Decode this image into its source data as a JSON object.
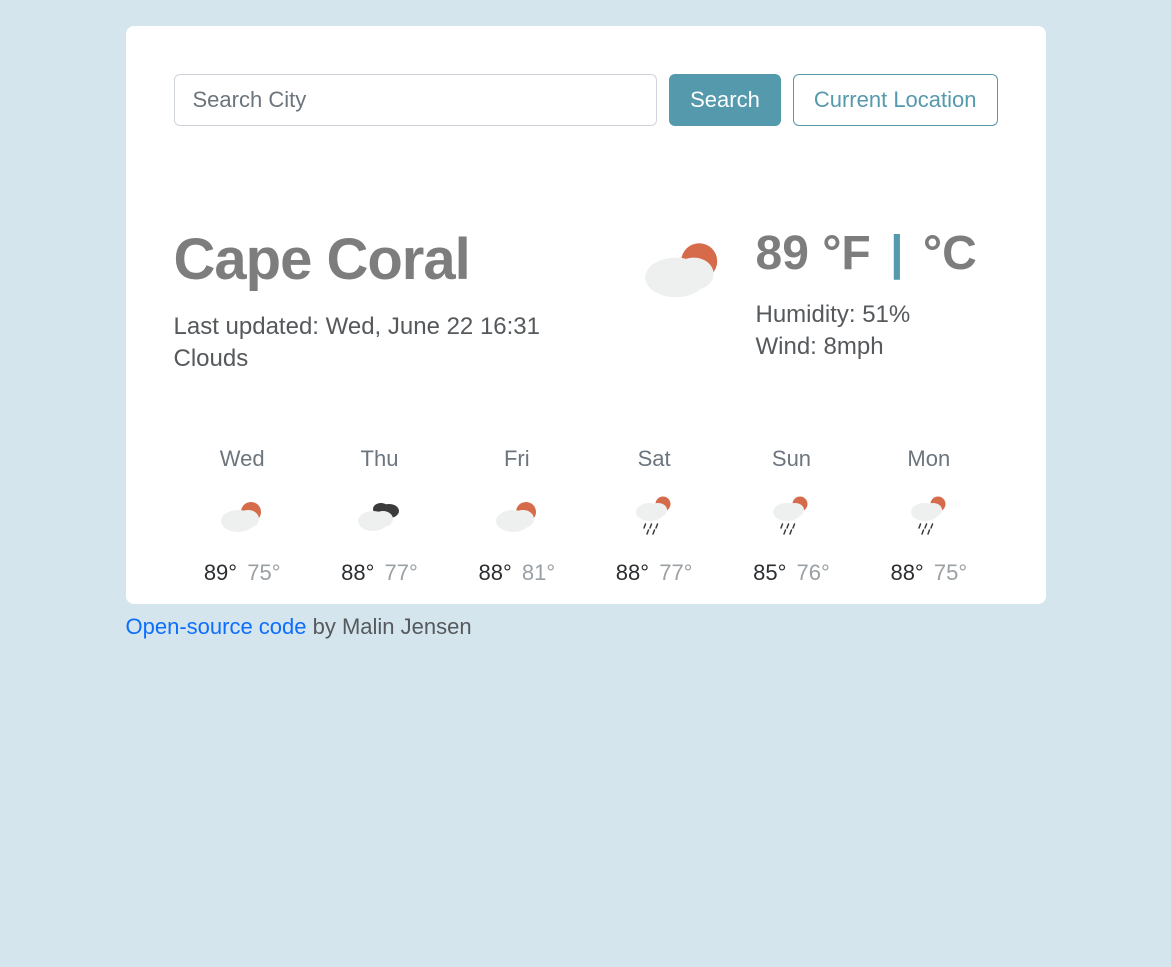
{
  "search": {
    "placeholder": "Search City",
    "value": "",
    "search_label": "Search",
    "location_label": "Current Location"
  },
  "current": {
    "city": "Cape Coral",
    "last_updated": "Last updated: Wed, June 22 16:31",
    "condition": "Clouds",
    "temp": "89",
    "unit_f": "°F",
    "separator": "|",
    "unit_c": "°C",
    "humidity": "Humidity: 51%",
    "wind": "Wind: 8mph",
    "icon": "partly-cloudy"
  },
  "forecast": [
    {
      "day": "Wed",
      "icon": "partly-cloudy",
      "hi": "89°",
      "lo": "75°"
    },
    {
      "day": "Thu",
      "icon": "broken-clouds",
      "hi": "88°",
      "lo": "77°"
    },
    {
      "day": "Fri",
      "icon": "partly-cloudy",
      "hi": "88°",
      "lo": "81°"
    },
    {
      "day": "Sat",
      "icon": "rain-sun",
      "hi": "88°",
      "lo": "77°"
    },
    {
      "day": "Sun",
      "icon": "rain-sun",
      "hi": "85°",
      "lo": "76°"
    },
    {
      "day": "Mon",
      "icon": "rain-sun",
      "hi": "88°",
      "lo": "75°"
    }
  ],
  "footer": {
    "link_text": "Open-source code",
    "rest": " by Malin Jensen"
  }
}
